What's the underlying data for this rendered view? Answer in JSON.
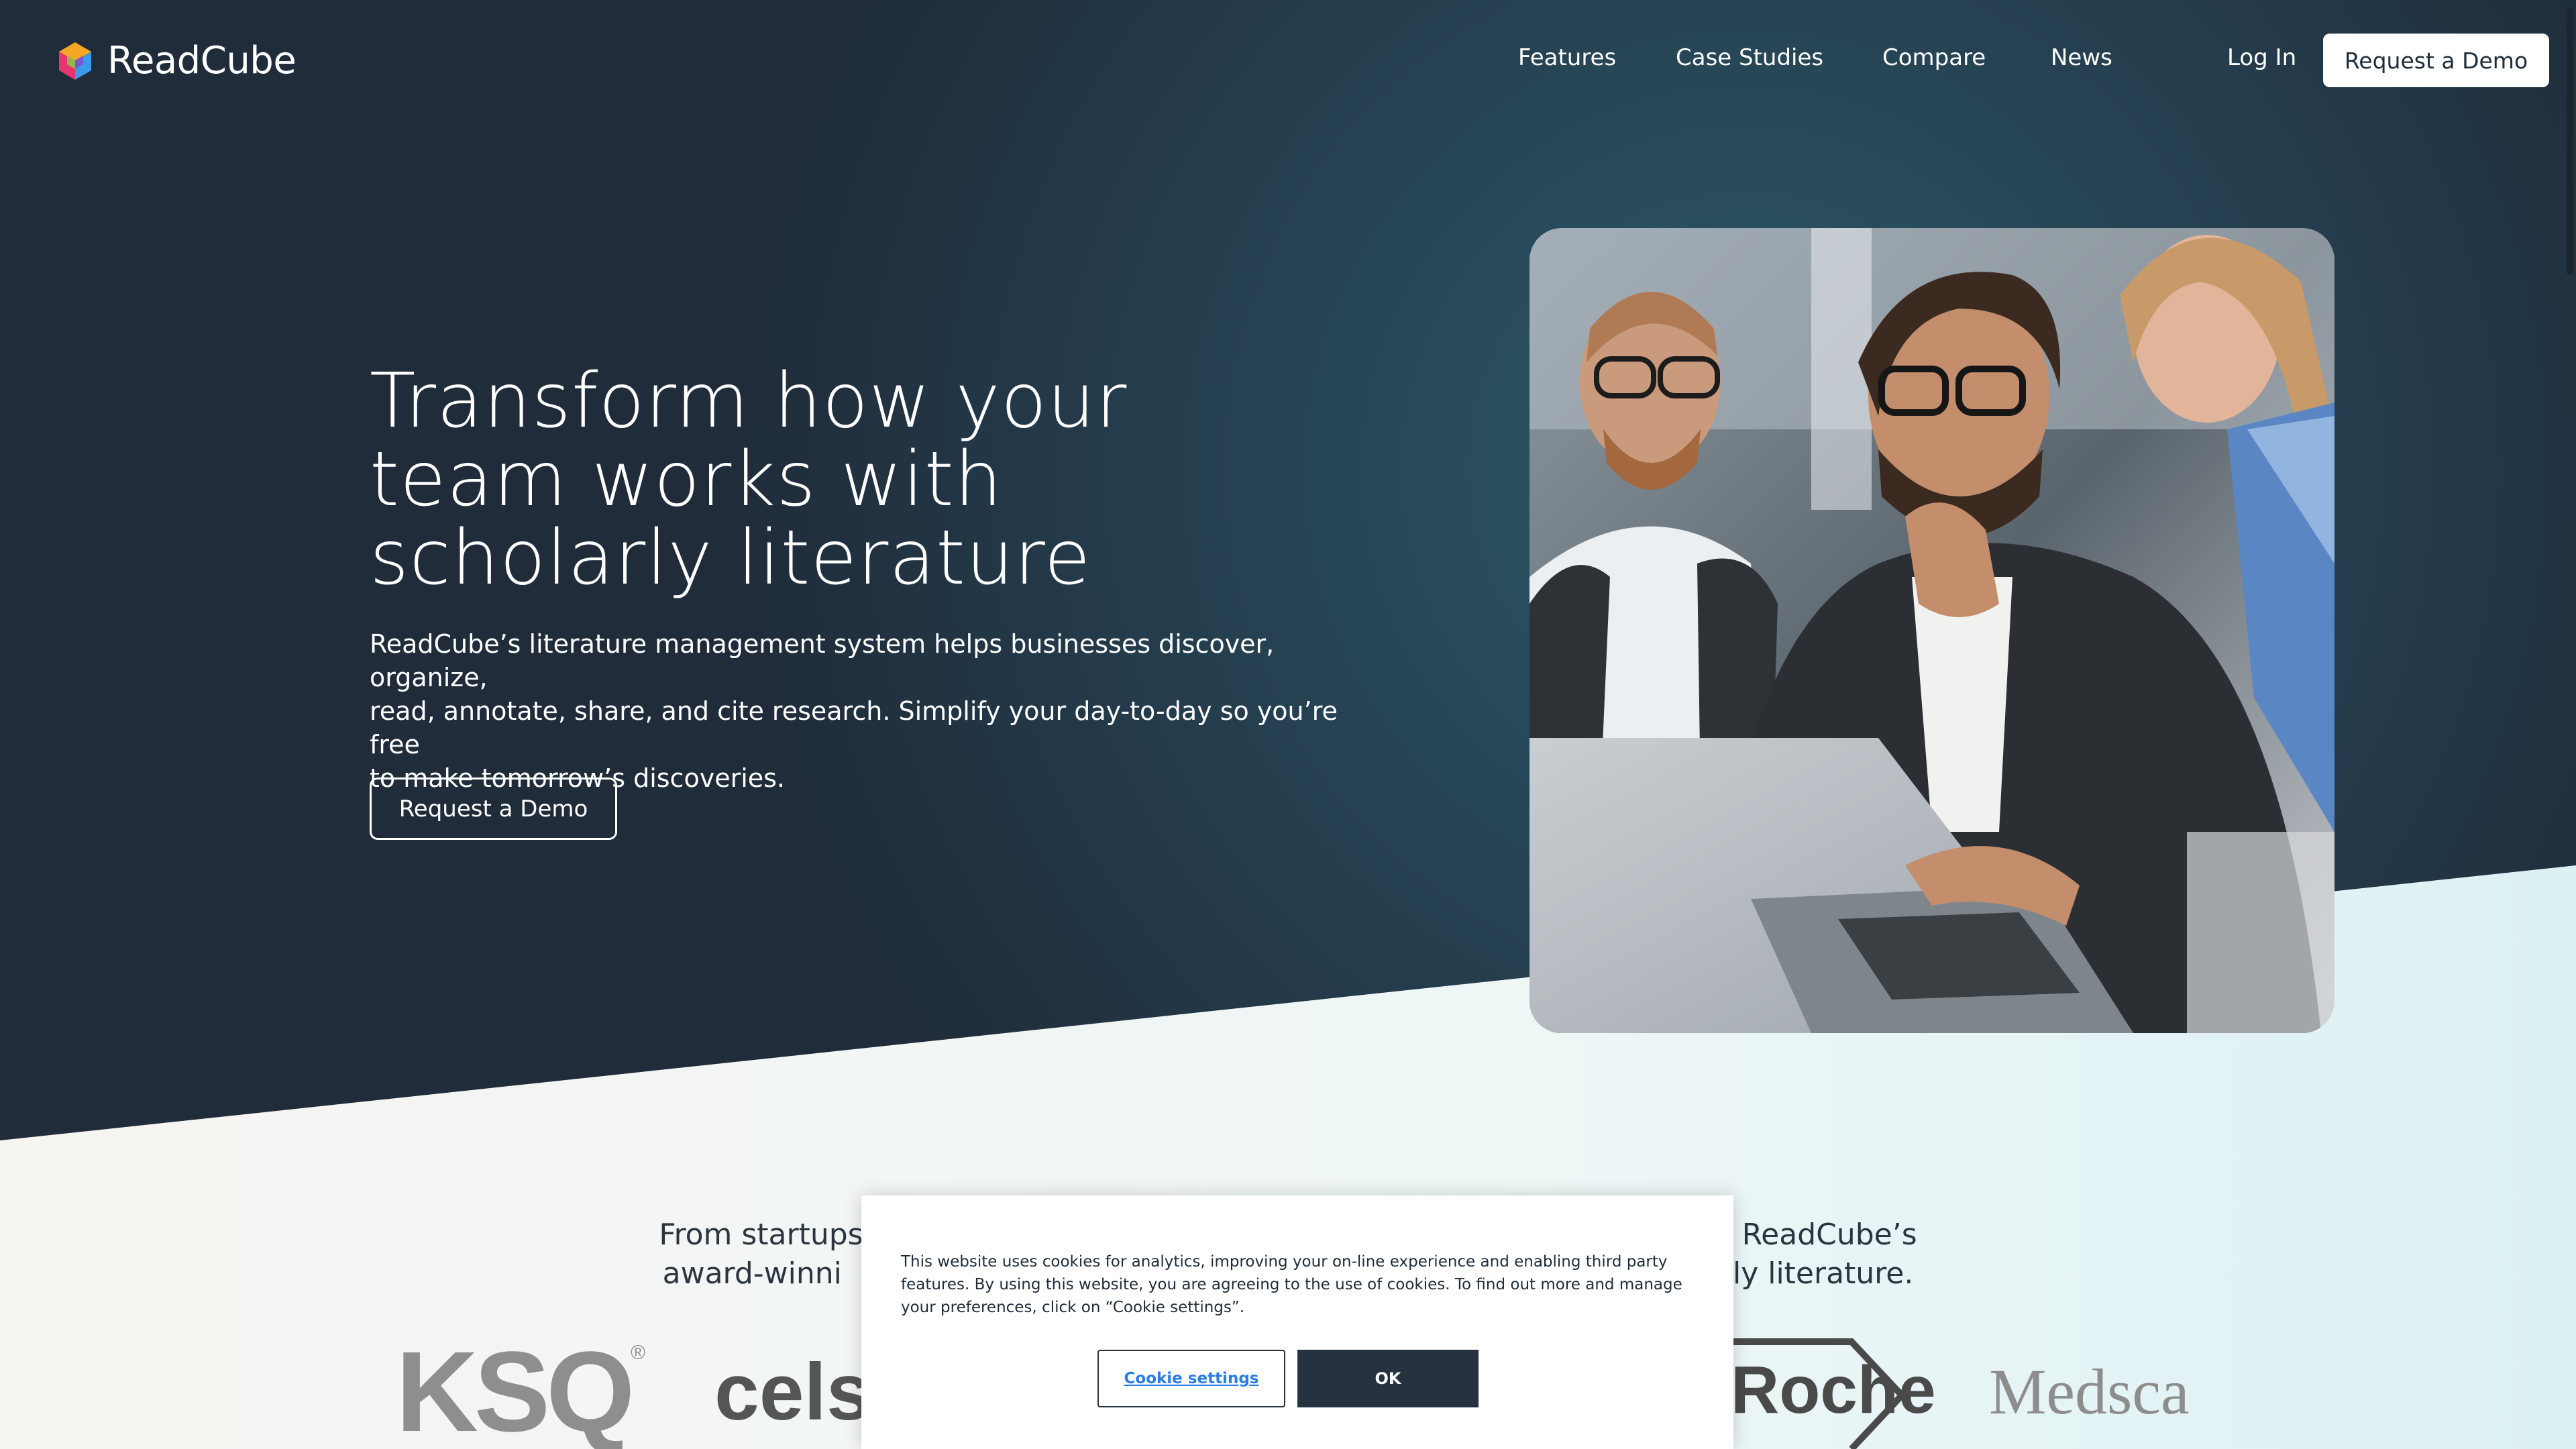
{
  "brand": {
    "name": "ReadCube"
  },
  "nav": {
    "links": [
      "Features",
      "Case Studies",
      "Compare",
      "News"
    ],
    "login": "Log In",
    "cta": "Request a Demo"
  },
  "hero": {
    "title_lines": [
      "Transform how your",
      "team works with",
      "scholarly literature"
    ],
    "subtitle_lines": [
      "ReadCube’s literature management system helps businesses discover, organize,",
      "read, annotate, share, and cite research. Simplify your day-to-day so you’re free",
      "to make tomorrow’s discoveries."
    ],
    "cta": "Request a Demo"
  },
  "customers": {
    "line1_left": "From startups",
    "line1_right": "ReadCube’s",
    "line2_left": "award-winni",
    "line2_right": "rly literature.",
    "logos": [
      "KSQ",
      "cels",
      "Roche",
      "Medsca"
    ]
  },
  "cookie": {
    "text": "This website uses cookies for analytics, improving your on-line experience and enabling third party features. By using this website, you are agreeing to the use of cookies. To find out more and manage your preferences, click on “Cookie settings”.",
    "settings_label": "Cookie settings",
    "ok_label": "OK"
  },
  "colors": {
    "hero_dark": "#22303d",
    "hero_teal": "#2a5464",
    "light_bg": "#f8f7f5",
    "light_teal": "#dff2f4",
    "button_dark": "#26323f",
    "link_blue": "#2a7de1"
  }
}
